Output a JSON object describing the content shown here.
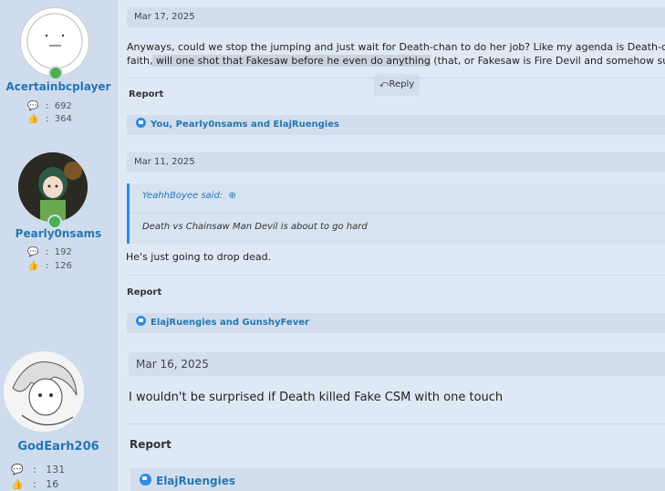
{
  "posts": [
    {
      "user": "Acertainbcplayer",
      "messages": "692",
      "likes": "364",
      "date": "Mar 17, 2025",
      "line1": "Anyways, could we stop the jumping and just wait for Death-chan to do her job? Like my agenda is Death-chan solo",
      "line2_pre": "faith,",
      "line2_hl": " will one shot that Fakesaw before he even do anything",
      "line2_post": " (that, or Fakesaw is Fire Devil and somehow survives)",
      "reply_label": "Reply",
      "report_label": "Report",
      "reactions": "You, Pearly0nsams and ElajRuengies"
    },
    {
      "user": "Pearly0nsams",
      "messages": "192",
      "likes": "126",
      "date": "Mar 11, 2025",
      "quote_author": "YeahhBoyee said:",
      "quote_text": "Death vs Chainsaw Man Devil is about to go hard",
      "text": "He's just going to drop dead.",
      "report_label": "Report",
      "reactions": "ElajRuengies and GunshyFever"
    },
    {
      "user": "GodEarh206",
      "messages": "131",
      "likes": "16",
      "date": "Mar 16, 2025",
      "text": "I wouldn't be surprised if Death killed Fake CSM with one touch",
      "report_label": "Report",
      "reactions": "ElajRuengies"
    }
  ],
  "icons": {
    "messages": "speech-bubbles-icon",
    "likes": "thumbs-up-icon",
    "reply": "reply-arrow-icon",
    "quote_jump": "arrow-up-circle-icon",
    "reaction": "like-icon"
  },
  "colors": {
    "accent": "#2577b1",
    "like": "#2e8be0",
    "online": "#4caf50"
  }
}
